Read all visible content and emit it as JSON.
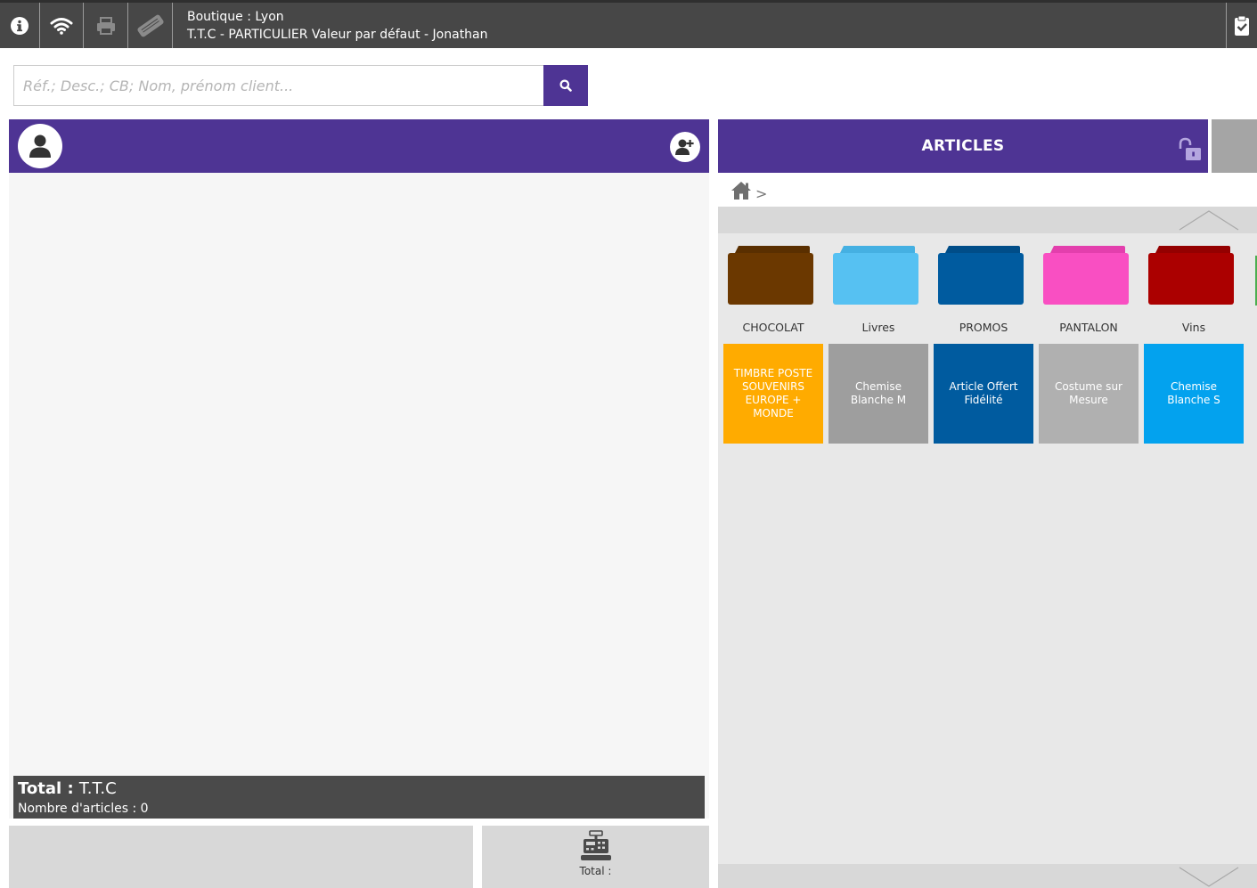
{
  "topbar": {
    "line1": "Boutique : Lyon",
    "line2": "T.T.C - PARTICULIER Valeur par défaut - Jonathan",
    "icons": [
      "info-icon",
      "wifi-icon",
      "printer-icon",
      "card-reader-icon",
      "clipboard-check-icon"
    ]
  },
  "search": {
    "placeholder": "Réf.; Desc.; CB; Nom, prénom client..."
  },
  "ticket": {
    "total_label": "Total :",
    "total_mode": "T.T.C",
    "count_label": "Nombre d'articles : 0",
    "pay_label": "Total :"
  },
  "articles": {
    "title": "ARTICLES",
    "breadcrumb_sep": ">",
    "folders": [
      {
        "label": "CHOCOLAT",
        "color": "#6b3800",
        "tab": "#5a2f00"
      },
      {
        "label": "Livres",
        "color": "#56c1f2",
        "tab": "#45b0e2"
      },
      {
        "label": "PROMOS",
        "color": "#005b9f",
        "tab": "#004d88"
      },
      {
        "label": "PANTALON",
        "color": "#f94fc2",
        "tab": "#e33fad"
      },
      {
        "label": "Vins",
        "color": "#ab0000",
        "tab": "#940000"
      }
    ],
    "tiles": [
      {
        "label": "TIMBRE POSTE SOUVENIRS EUROPE + MONDE",
        "color": "#ffab00"
      },
      {
        "label": "Chemise Blanche M",
        "color": "#9e9e9e"
      },
      {
        "label": "Article Offert Fidélité",
        "color": "#005b9f"
      },
      {
        "label": "Costume sur Mesure",
        "color": "#b0b0b0"
      },
      {
        "label": "Chemise Blanche S",
        "color": "#03a2ee"
      }
    ]
  },
  "colors": {
    "accent": "#4e3494",
    "topbar": "#474747"
  }
}
